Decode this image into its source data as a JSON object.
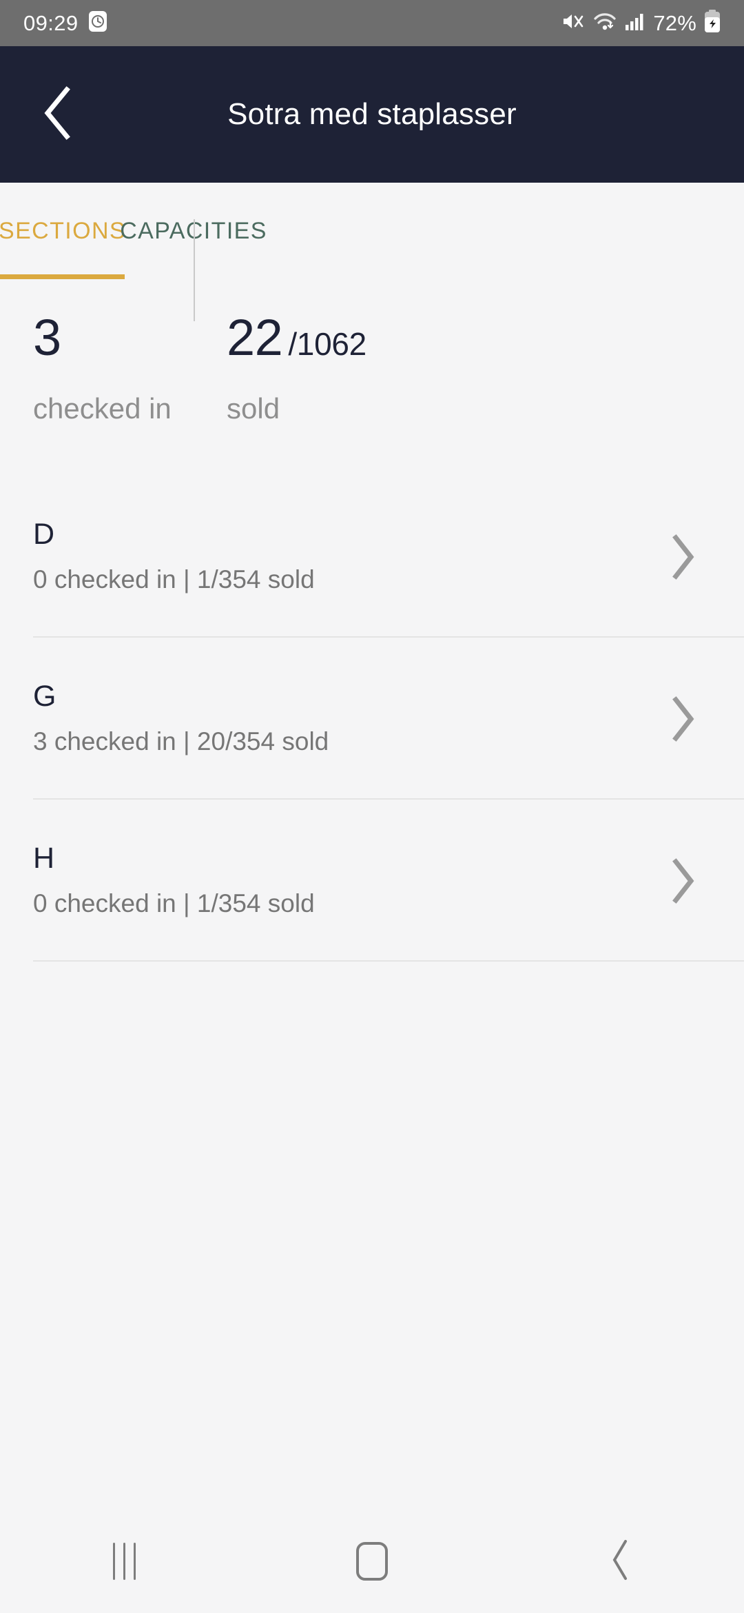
{
  "statusbar": {
    "time": "09:29",
    "battery_percent": "72%",
    "icons": [
      "alarm-clock-icon",
      "mute-icon",
      "wifi-icon",
      "cellular-signal-icon",
      "battery-charging-icon"
    ]
  },
  "appbar": {
    "title": "Sotra med staplasser",
    "back_icon": "back-chevron-icon"
  },
  "tabs": {
    "items": [
      {
        "label": "SECTIONS",
        "active": true,
        "color": "#dba93f"
      },
      {
        "label": "CAPACITIES",
        "active": false,
        "color": "#4b6b5f"
      }
    ]
  },
  "summary": {
    "checked_in": {
      "value": "3",
      "label": "checked in"
    },
    "sold": {
      "value": "22",
      "denominator": "/1062",
      "label": "sold"
    }
  },
  "sections": [
    {
      "name": "D",
      "detail": "0 checked in | 1/354 sold",
      "chevron": "chevron-right-icon"
    },
    {
      "name": "G",
      "detail": "3 checked in | 20/354 sold",
      "chevron": "chevron-right-icon"
    },
    {
      "name": "H",
      "detail": "0 checked in | 1/354 sold",
      "chevron": "chevron-right-icon"
    }
  ],
  "navbar": {
    "recents": "recents-icon",
    "home": "home-icon",
    "back": "nav-back-icon"
  },
  "colors": {
    "appbar_bg": "#1e2236",
    "page_bg": "#f5f5f6",
    "statusbar_bg": "#6e6e6e",
    "accent": "#dba93f",
    "secondary": "#4b6b5f",
    "muted_text": "#8e8e8e"
  }
}
